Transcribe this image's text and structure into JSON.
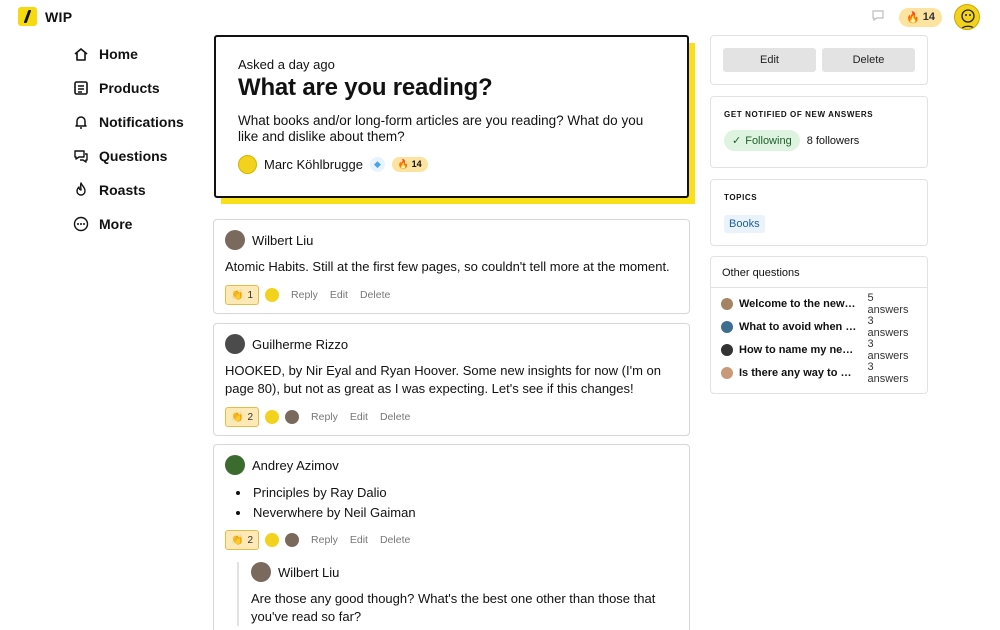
{
  "brand": {
    "name": "WIP"
  },
  "header": {
    "streak": "14"
  },
  "nav": [
    {
      "label": "Home",
      "icon": "home-icon"
    },
    {
      "label": "Products",
      "icon": "products-icon"
    },
    {
      "label": "Notifications",
      "icon": "bell-icon"
    },
    {
      "label": "Questions",
      "icon": "questions-icon"
    },
    {
      "label": "Roasts",
      "icon": "flame-icon"
    },
    {
      "label": "More",
      "icon": "more-icon"
    }
  ],
  "question": {
    "asked": "Asked a day ago",
    "title": "What are you reading?",
    "body": "What books and/or long-form articles are you reading? What do you like and dislike about them?",
    "author": "Marc Köhlbrugge",
    "streak": "14"
  },
  "answers": [
    {
      "author": "Wilbert Liu",
      "text": "Atomic Habits. Still at the first few pages, so couldn't tell more at the moment.",
      "claps": "1",
      "reply": "Reply",
      "edit": "Edit",
      "delete": "Delete"
    },
    {
      "author": "Guilherme Rizzo",
      "text": "HOOKED, by Nir Eyal and Ryan Hoover. Some new insights for now (I'm on page 80), but not as great as I was expecting. Let's see if this changes!",
      "claps": "2",
      "reply": "Reply",
      "edit": "Edit",
      "delete": "Delete"
    },
    {
      "author": "Andrey Azimov",
      "list": [
        "Principles by Ray Dalio",
        "Neverwhere by Neil Gaiman"
      ],
      "claps": "2",
      "reply": "Reply",
      "edit": "Edit",
      "delete": "Delete",
      "nested": {
        "author": "Wilbert Liu",
        "text": "Are those any good though? What's the best one other than those that you've read so far?"
      }
    }
  ],
  "sidebar_right": {
    "edit_label": "Edit",
    "delete_label": "Delete",
    "notify_heading": "GET NOTIFIED OF NEW ANSWERS",
    "following_label": "Following",
    "followers": "8 followers",
    "topics_heading": "TOPICS",
    "topic": "Books",
    "other_heading": "Other questions",
    "other": [
      {
        "title": "Welcome to the new f...",
        "count": "5 answers"
      },
      {
        "title": "What to avoid when b...",
        "count": "3 answers"
      },
      {
        "title": "How to name my new ...",
        "count": "3 answers"
      },
      {
        "title": "Is there any way to po...",
        "count": "3 answers"
      }
    ]
  },
  "colors": {
    "brand_yellow": "#f8e11a",
    "following_green": "#def4e1",
    "topic_blue": "#eaf3fb",
    "clap_bg": "#fde9b5"
  }
}
